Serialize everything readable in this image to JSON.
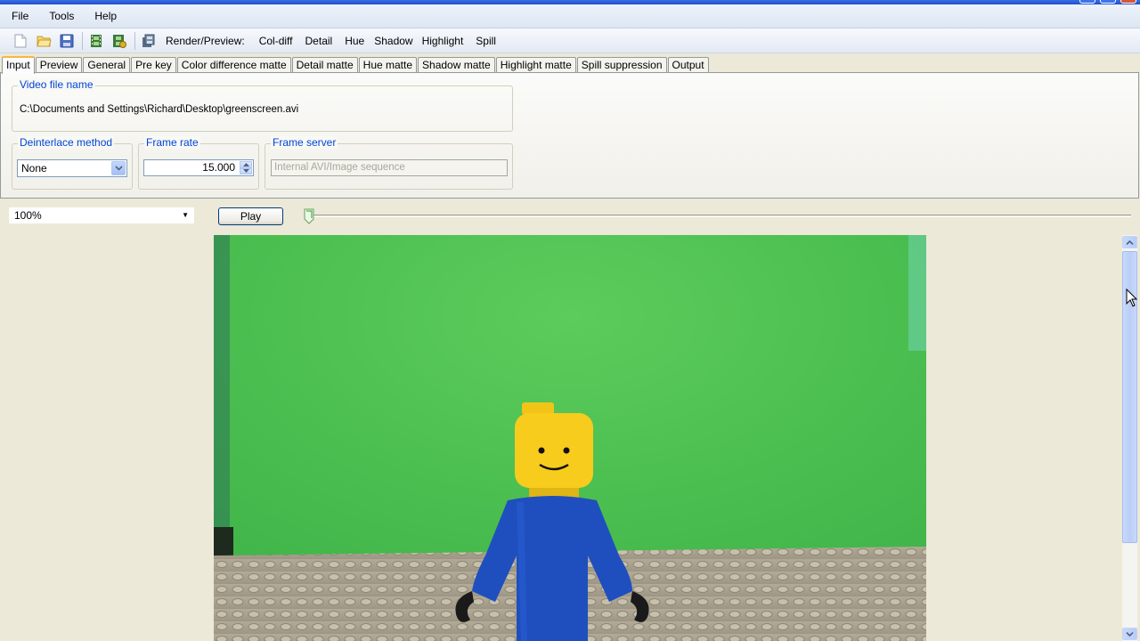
{
  "menu": {
    "items": [
      {
        "label": "File"
      },
      {
        "label": "Tools"
      },
      {
        "label": "Help"
      }
    ]
  },
  "toolbar": {
    "icons": [
      "new-file-icon",
      "open-folder-icon",
      "save-icon",
      "film-icon",
      "film-export-icon",
      "batch-render-icon"
    ],
    "render_label": "Render/Preview:",
    "buttons": [
      {
        "label": "Col-diff"
      },
      {
        "label": "Detail"
      },
      {
        "label": "Hue"
      },
      {
        "label": "Shadow"
      },
      {
        "label": "Highlight"
      },
      {
        "label": "Spill"
      }
    ]
  },
  "tabs": [
    {
      "label": "Input",
      "active": true
    },
    {
      "label": "Preview"
    },
    {
      "label": "General"
    },
    {
      "label": "Pre key"
    },
    {
      "label": "Color difference matte"
    },
    {
      "label": "Detail matte"
    },
    {
      "label": "Hue matte"
    },
    {
      "label": "Shadow matte"
    },
    {
      "label": "Highlight matte"
    },
    {
      "label": "Spill suppression"
    },
    {
      "label": "Output"
    }
  ],
  "input_panel": {
    "video_file": {
      "legend": "Video file name",
      "value": "C:\\Documents and Settings\\Richard\\Desktop\\greenscreen.avi"
    },
    "deinterlace": {
      "legend": "Deinterlace method",
      "value": "None"
    },
    "frame_rate": {
      "legend": "Frame rate",
      "value": "15.000"
    },
    "frame_server": {
      "legend": "Frame server",
      "value": "Internal AVI/Image sequence"
    }
  },
  "playback": {
    "zoom": "100%",
    "play_label": "Play",
    "position_fraction": 0.0
  },
  "colors": {
    "accent_blue": "#0046d5",
    "green_screen": "#4fc64f",
    "tab_highlight": "#f7b741"
  }
}
